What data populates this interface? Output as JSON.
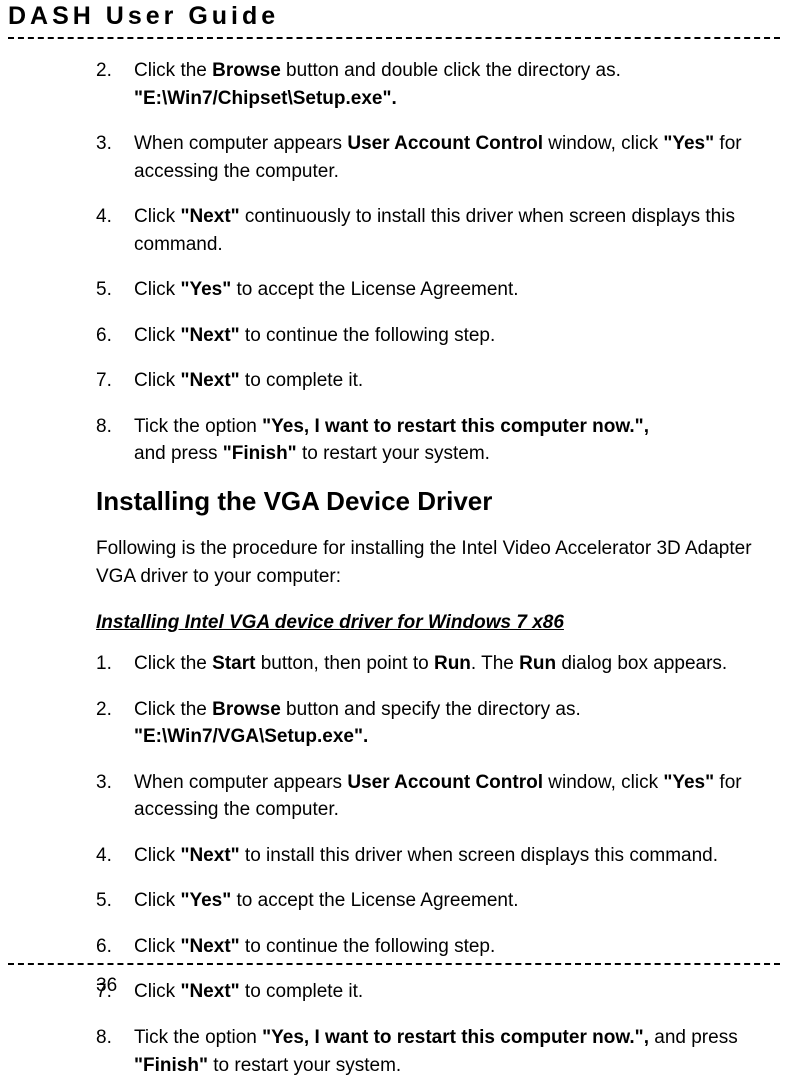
{
  "header": {
    "title": "DASH  User  Guide"
  },
  "steps1": [
    {
      "num": "2.",
      "html": "Click the <b>Browse</b> button and double click the directory as. <b>\"E:\\Win7/Chipset\\Setup.exe\".</b>"
    },
    {
      "num": "3.",
      "html": "When computer appears <b>User Account Control</b> window, click <b>\"Yes\"</b> for accessing the computer."
    },
    {
      "num": "4.",
      "html": "Click <b>\"Next\"</b> continuously to install this driver when screen displays this command."
    },
    {
      "num": "5.",
      "html": "Click <b>\"Yes\"</b> to accept the License Agreement."
    },
    {
      "num": "6.",
      "html": "Click <b>\"Next\"</b> to continue the following step."
    },
    {
      "num": "7.",
      "html": "Click <b>\"Next\"</b> to complete it."
    },
    {
      "num": "8.",
      "html": "Tick the option <b>\"Yes, I want to restart this computer now.\",</b><br>and press <b>\"Finish\"</b> to restart your system."
    }
  ],
  "sectionHeading": "Installing the VGA Device Driver",
  "introText": "Following is the procedure for installing the Intel Video Accelerator 3D Adapter VGA driver to your computer:",
  "subHeading": "Installing Intel VGA device driver for Windows 7 x86",
  "steps2": [
    {
      "num": "1.",
      "html": "Click the <b>Start</b> button, then point to <b>Run</b>. The <b>Run</b> dialog box appears."
    },
    {
      "num": "2.",
      "html": "Click the <b>Browse</b> button and specify the directory as. <b>\"E:\\Win7/VGA\\Setup.exe\".</b>"
    },
    {
      "num": "3.",
      "html": "When computer appears <b>User Account Control</b> window, click <b>\"Yes\"</b> for accessing the computer."
    },
    {
      "num": "4.",
      "html": "Click <b>\"Next\"</b> to install this driver when screen displays this command."
    },
    {
      "num": "5.",
      "html": "Click <b>\"Yes\"</b> to accept the License Agreement."
    },
    {
      "num": "6.",
      "html": "Click <b>\"Next\"</b> to continue the following step."
    },
    {
      "num": "7.",
      "html": "Click <b>\"Next\"</b> to complete it."
    },
    {
      "num": "8.",
      "html": "Tick the option <b>\"Yes, I want to restart this computer now.\",</b> and press <b>\"Finish\"</b> to restart your system."
    }
  ],
  "pageNumber": "36"
}
